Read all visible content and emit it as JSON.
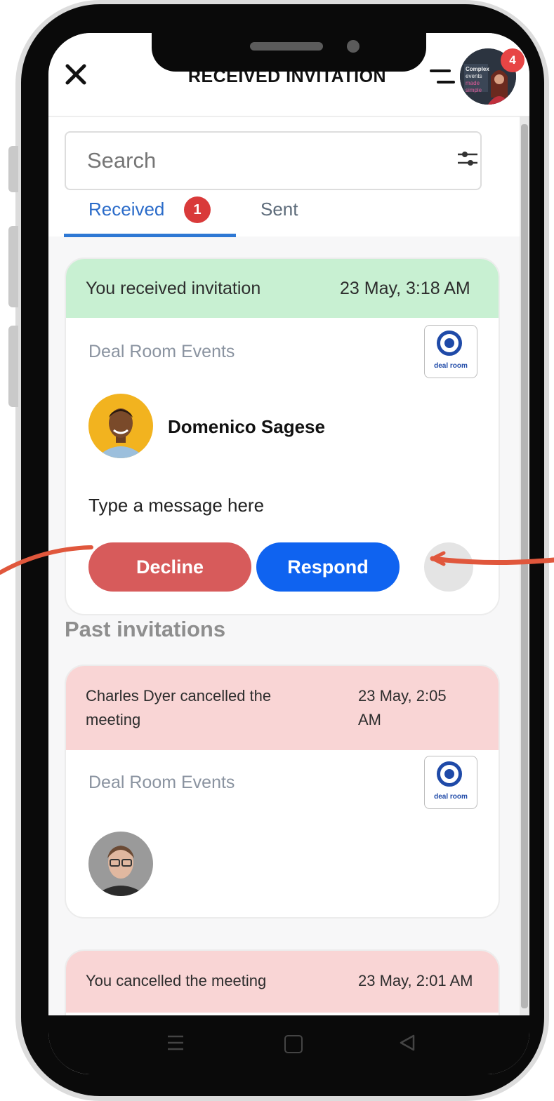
{
  "header": {
    "title": "RECEIVED INVITATION",
    "notification_count": "4"
  },
  "search": {
    "placeholder": "Search"
  },
  "tabs": [
    {
      "label": "Received",
      "badge": "1",
      "active": true
    },
    {
      "label": "Sent",
      "active": false
    }
  ],
  "active_invitation": {
    "status_text": "You received invitation",
    "date": "23 May, 3:18 AM",
    "organization": "Deal Room Events",
    "logo_text": "deal room",
    "person_name": "Domenico Sagese",
    "message_placeholder": "Type a message here",
    "decline_label": "Decline",
    "respond_label": "Respond"
  },
  "past_section_title": "Past invitations",
  "past_invitations": [
    {
      "status_line1": "Charles Dyer cancelled the",
      "status_line2": "meeting",
      "date_line1": "23 May, 2:05",
      "date_line2": "AM",
      "organization": "Deal Room Events",
      "logo_text": "deal room"
    },
    {
      "status_text": "You cancelled the meeting",
      "date": "23 May, 2:01 AM"
    }
  ],
  "colors": {
    "received_header": "#c8f0d2",
    "cancelled_header": "#f9d5d5",
    "decline": "#d75b5b",
    "respond": "#0f63f0",
    "tab_active": "#2a6bc9",
    "badge": "#d93a3a",
    "annotation_arrow": "#e0573c"
  }
}
